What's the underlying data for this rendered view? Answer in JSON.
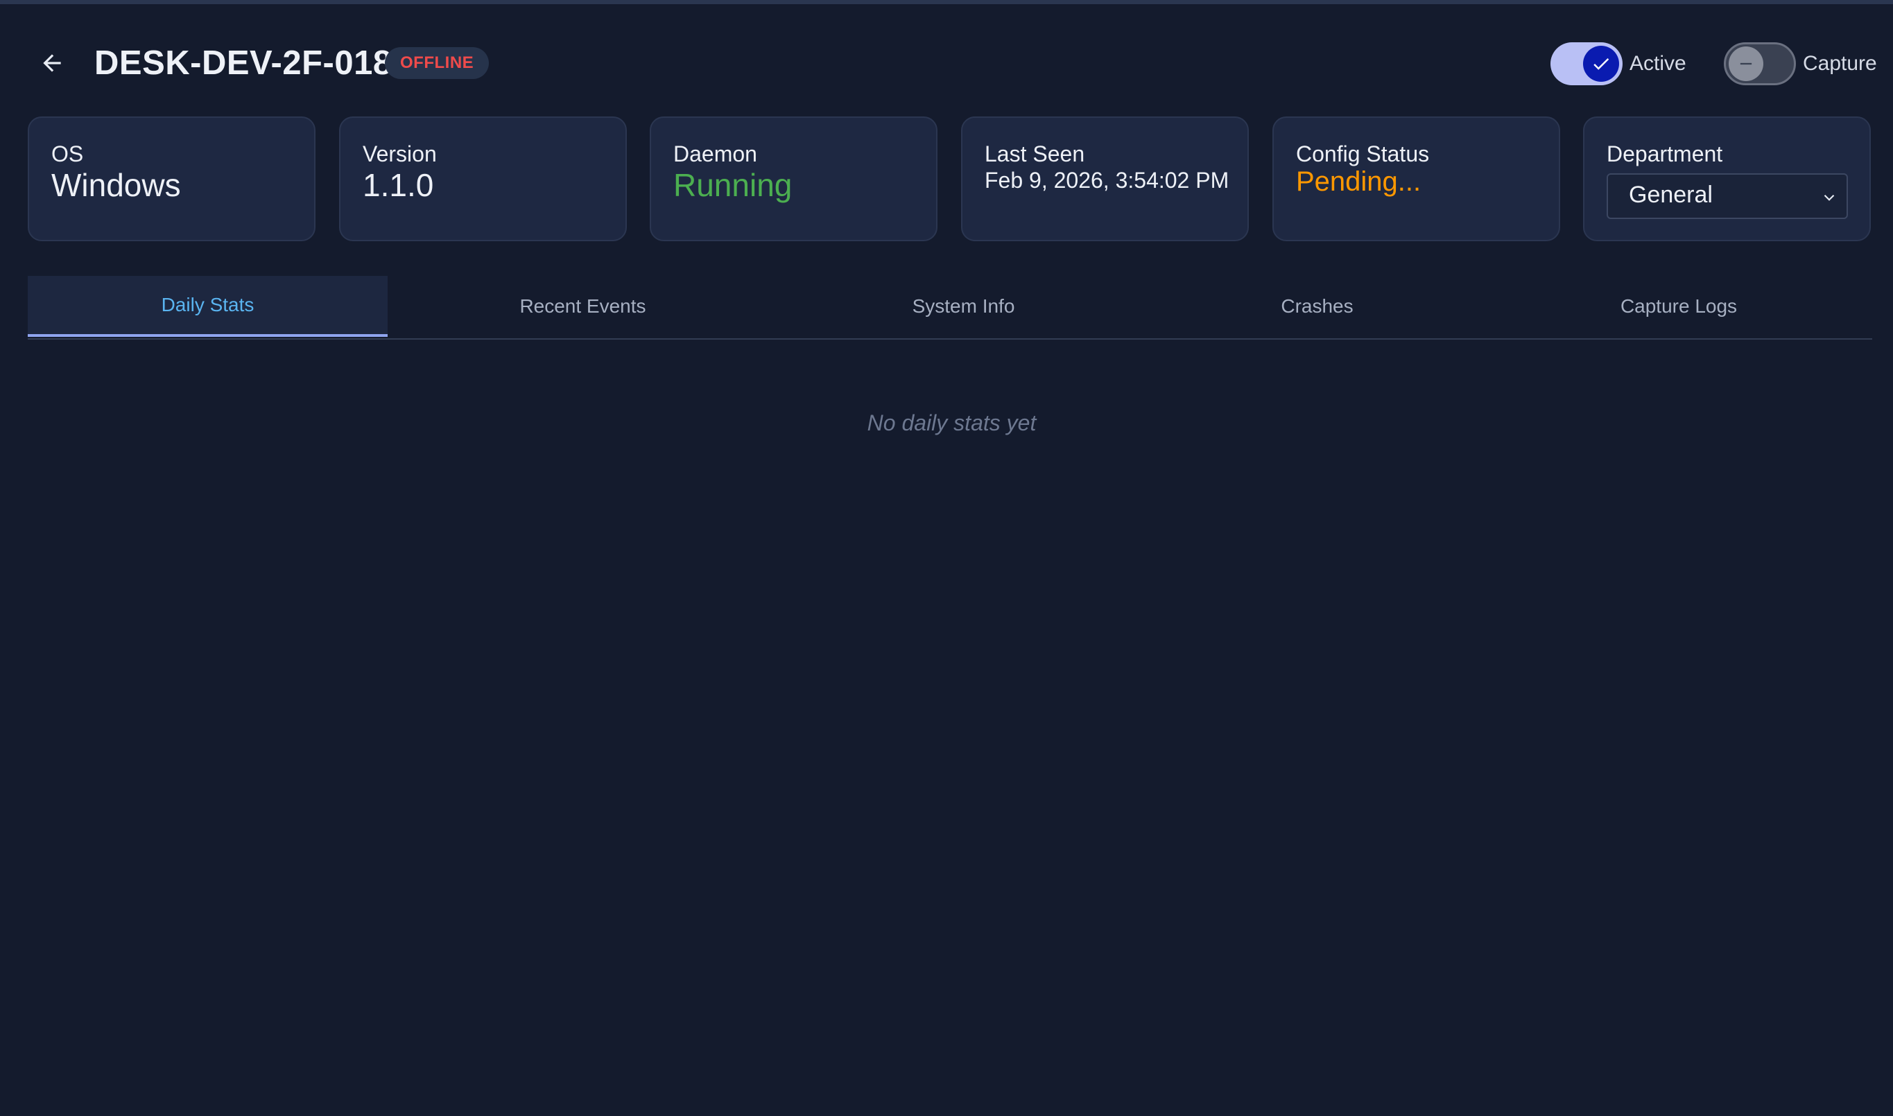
{
  "header": {
    "title": "DESK-DEV-2F-018",
    "status_badge": "OFFLINE",
    "back_icon": "arrow-left-icon",
    "toggles": [
      {
        "label": "Active",
        "state": "on",
        "icon": "check-icon"
      },
      {
        "label": "Capture",
        "state": "off",
        "icon": "minus-icon"
      }
    ]
  },
  "cards": {
    "os": {
      "label": "OS",
      "value": "Windows"
    },
    "version": {
      "label": "Version",
      "value": "1.1.0"
    },
    "daemon": {
      "label": "Daemon",
      "value": "Running"
    },
    "last_seen": {
      "label": "Last Seen",
      "value": "Feb 9, 2026, 3:54:02 PM"
    },
    "config_status": {
      "label": "Config Status",
      "value": "Pending..."
    },
    "department": {
      "label": "Department",
      "selected": "General",
      "icon": "chevron-down-icon"
    }
  },
  "tabs": [
    {
      "label": "Daily Stats",
      "active": true
    },
    {
      "label": "Recent Events",
      "active": false
    },
    {
      "label": "System Info",
      "active": false
    },
    {
      "label": "Crashes",
      "active": false
    },
    {
      "label": "Capture Logs",
      "active": false
    }
  ],
  "main": {
    "empty_message": "No daily stats yet"
  },
  "colors": {
    "background": "#141b2d",
    "card": "#1e2842",
    "running": "#4caf50",
    "pending": "#ff9800",
    "offline": "#ef4b4b",
    "active_tab": "#5ab4f0"
  }
}
